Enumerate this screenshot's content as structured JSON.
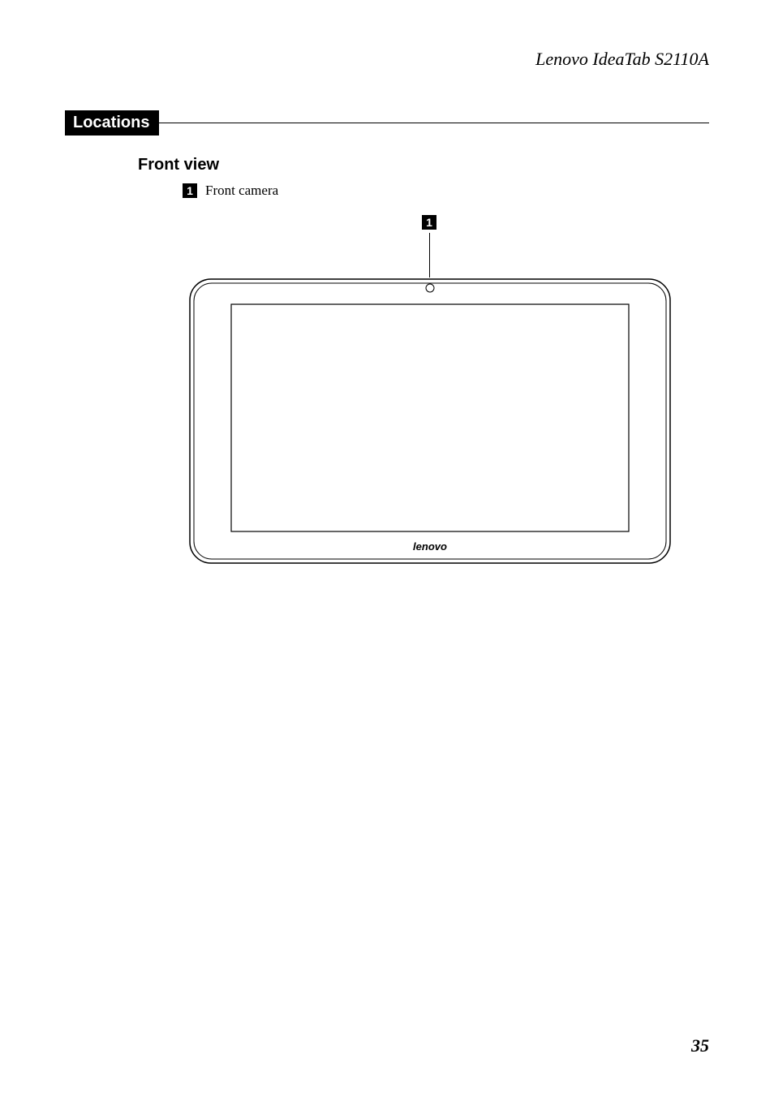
{
  "header": {
    "title": "Lenovo IdeaTab S2110A"
  },
  "section": {
    "label": "Locations"
  },
  "subsection": {
    "title": "Front view"
  },
  "legend": {
    "items": [
      {
        "num": "1",
        "text": "Front camera"
      }
    ]
  },
  "diagram": {
    "callout_num": "1",
    "brand": "lenovo"
  },
  "page_number": "35"
}
